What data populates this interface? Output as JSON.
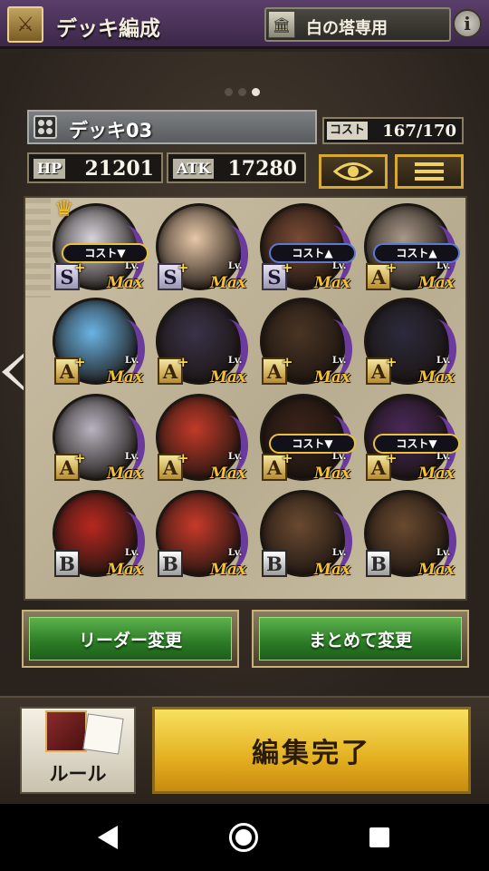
{
  "header": {
    "title": "デッキ編成",
    "tower_label": "白の塔専用",
    "info_label": "i"
  },
  "pagination": {
    "total": 3,
    "active": 3
  },
  "deck": {
    "name": "デッキ03",
    "cost_label": "コスト",
    "cost_value": "167/170",
    "hp_label": "HP",
    "hp_value": "21201",
    "atk_label": "ATK",
    "atk_value": "17280"
  },
  "toolbar": {
    "view_icon": "eye-icon",
    "menu_icon": "list-icon"
  },
  "cards": [
    {
      "rank": "S",
      "plus": "+",
      "lv": "Lv.",
      "level": "Max",
      "cost_tag": "コスト",
      "cost_dir": "down",
      "leader": true,
      "color": "#d8d4dc"
    },
    {
      "rank": "S",
      "plus": "+",
      "lv": "Lv.",
      "level": "Max",
      "cost_tag": "",
      "cost_dir": "",
      "leader": false,
      "color": "#e8c8a8"
    },
    {
      "rank": "S",
      "plus": "+",
      "lv": "Lv.",
      "level": "Max",
      "cost_tag": "コスト",
      "cost_dir": "up",
      "leader": false,
      "color": "#7a4a34"
    },
    {
      "rank": "A",
      "plus": "+",
      "lv": "Lv.",
      "level": "Max",
      "cost_tag": "コスト",
      "cost_dir": "up",
      "leader": false,
      "color": "#a89888"
    },
    {
      "rank": "A",
      "plus": "+",
      "lv": "Lv.",
      "level": "Max",
      "cost_tag": "",
      "cost_dir": "",
      "leader": false,
      "color": "#6ab4e4"
    },
    {
      "rank": "A",
      "plus": "+",
      "lv": "Lv.",
      "level": "Max",
      "cost_tag": "",
      "cost_dir": "",
      "leader": false,
      "color": "#3a3248"
    },
    {
      "rank": "A",
      "plus": "+",
      "lv": "Lv.",
      "level": "Max",
      "cost_tag": "",
      "cost_dir": "",
      "leader": false,
      "color": "#4a3424"
    },
    {
      "rank": "A",
      "plus": "+",
      "lv": "Lv.",
      "level": "Max",
      "cost_tag": "",
      "cost_dir": "",
      "leader": false,
      "color": "#2c2a3c"
    },
    {
      "rank": "A",
      "plus": "+",
      "lv": "Lv.",
      "level": "Max",
      "cost_tag": "",
      "cost_dir": "",
      "leader": false,
      "color": "#b8b4c0"
    },
    {
      "rank": "A",
      "plus": "+",
      "lv": "Lv.",
      "level": "Max",
      "cost_tag": "",
      "cost_dir": "",
      "leader": false,
      "color": "#c23a28"
    },
    {
      "rank": "A",
      "plus": "+",
      "lv": "Lv.",
      "level": "Max",
      "cost_tag": "コスト",
      "cost_dir": "down",
      "leader": false,
      "color": "#3a2218"
    },
    {
      "rank": "A",
      "plus": "+",
      "lv": "Lv.",
      "level": "Max",
      "cost_tag": "コスト",
      "cost_dir": "down",
      "leader": false,
      "color": "#4a2858"
    },
    {
      "rank": "B",
      "plus": "",
      "lv": "Lv.",
      "level": "Max",
      "cost_tag": "",
      "cost_dir": "",
      "leader": false,
      "color": "#b82820"
    },
    {
      "rank": "B",
      "plus": "",
      "lv": "Lv.",
      "level": "Max",
      "cost_tag": "",
      "cost_dir": "",
      "leader": false,
      "color": "#c83a2a"
    },
    {
      "rank": "B",
      "plus": "",
      "lv": "Lv.",
      "level": "Max",
      "cost_tag": "",
      "cost_dir": "",
      "leader": false,
      "color": "#6a4a30"
    },
    {
      "rank": "B",
      "plus": "",
      "lv": "Lv.",
      "level": "Max",
      "cost_tag": "",
      "cost_dir": "",
      "leader": false,
      "color": "#6a4a30"
    }
  ],
  "actions": {
    "leader_change": "リーダー変更",
    "bulk_change": "まとめて変更"
  },
  "bottom": {
    "rule_label": "ルール",
    "complete_label": "編集完了"
  }
}
